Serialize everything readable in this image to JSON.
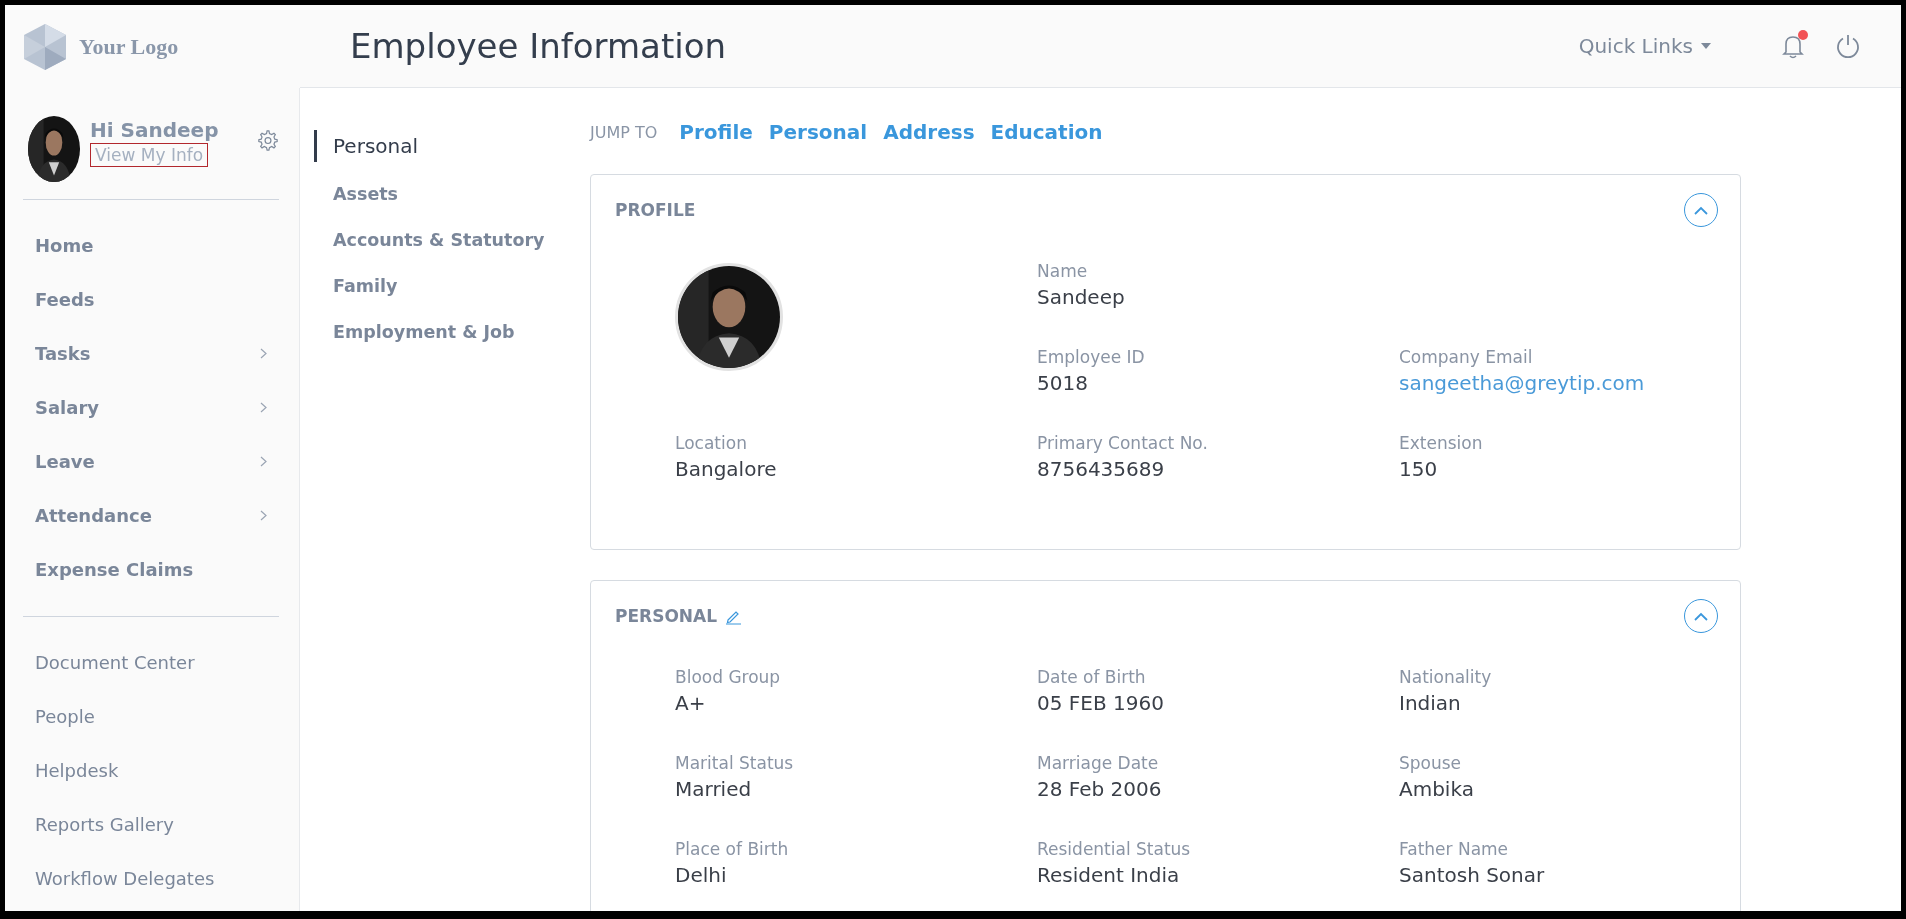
{
  "logo": {
    "text": "Your Logo"
  },
  "header": {
    "title": "Employee Information",
    "quick_links": "Quick Links",
    "has_notification": true
  },
  "user": {
    "greeting": "Hi Sandeep",
    "link": "View My Info"
  },
  "sidebar": {
    "main_items": [
      {
        "label": "Home",
        "has_submenu": false
      },
      {
        "label": "Feeds",
        "has_submenu": false
      },
      {
        "label": "Tasks",
        "has_submenu": true
      },
      {
        "label": "Salary",
        "has_submenu": true
      },
      {
        "label": "Leave",
        "has_submenu": true
      },
      {
        "label": "Attendance",
        "has_submenu": true
      },
      {
        "label": "Expense Claims",
        "has_submenu": false
      }
    ],
    "secondary_items": [
      {
        "label": "Document Center"
      },
      {
        "label": "People"
      },
      {
        "label": "Helpdesk"
      },
      {
        "label": "Reports Gallery"
      },
      {
        "label": "Workflow Delegates"
      }
    ]
  },
  "section_nav": [
    {
      "label": "Personal",
      "selected": true
    },
    {
      "label": "Assets",
      "selected": false
    },
    {
      "label": "Accounts & Statutory",
      "selected": false
    },
    {
      "label": "Family",
      "selected": false
    },
    {
      "label": "Employment & Job",
      "selected": false
    }
  ],
  "jump_to": {
    "label": "JUMP TO",
    "links": [
      "Profile",
      "Personal",
      "Address",
      "Education"
    ]
  },
  "cards": [
    {
      "kind": "profile",
      "title": "PROFILE",
      "editable": false,
      "expanded": true,
      "fields": [
        {
          "label": "Name",
          "value": "Sandeep",
          "link": false
        },
        {
          "label": "Employee ID",
          "value": "5018",
          "link": false
        },
        {
          "label": "Company Email",
          "value": "sangeetha@greytip.com",
          "link": true
        },
        {
          "label": "Location",
          "value": "Bangalore",
          "link": false
        },
        {
          "label": "Primary Contact No.",
          "value": "8756435689",
          "link": false
        },
        {
          "label": "Extension",
          "value": "150",
          "link": false
        }
      ]
    },
    {
      "kind": "details",
      "title": "PERSONAL",
      "editable": true,
      "expanded": true,
      "fields": [
        {
          "label": "Blood Group",
          "value": "A+",
          "link": false
        },
        {
          "label": "Date of Birth",
          "value": "05 FEB 1960",
          "link": false
        },
        {
          "label": "Nationality",
          "value": "Indian",
          "link": false
        },
        {
          "label": "Marital Status",
          "value": "Married",
          "link": false
        },
        {
          "label": "Marriage Date",
          "value": "28 Feb 2006",
          "link": false
        },
        {
          "label": "Spouse",
          "value": "Ambika",
          "link": false
        },
        {
          "label": "Place of Birth",
          "value": "Delhi",
          "link": false
        },
        {
          "label": "Residential Status",
          "value": "Resident India",
          "link": false
        },
        {
          "label": "Father Name",
          "value": "Santosh Sonar",
          "link": false
        }
      ]
    }
  ]
}
